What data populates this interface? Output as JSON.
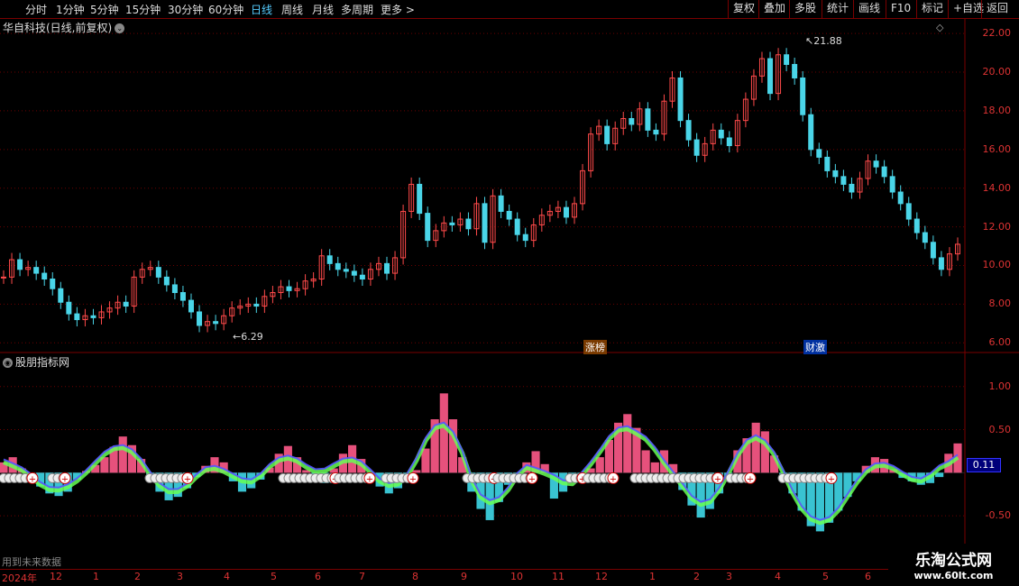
{
  "toolbar": {
    "periods": [
      "分时",
      "1分钟",
      "5分钟",
      "15分钟",
      "30分钟",
      "60分钟",
      "日线",
      "周线",
      "月线",
      "多周期",
      "更多 >"
    ],
    "active_index": 6,
    "right_buttons": [
      "复权",
      "叠加",
      "多股",
      "统计",
      "画线",
      "F10",
      "标记",
      "+自选",
      "返回"
    ]
  },
  "main": {
    "title": "华自科技(日线,前复权)",
    "high_label": "21.88",
    "low_label": "6.29",
    "events": [
      "涨榜",
      "财激"
    ]
  },
  "sub": {
    "title": "股朋指标网",
    "current_value": "0.11",
    "warning": "用到未来数据"
  },
  "date_axis": [
    "2024年",
    "12",
    "1",
    "2",
    "3",
    "4",
    "5",
    "6",
    "7",
    "8",
    "9",
    "10",
    "11",
    "12",
    "1",
    "2",
    "3",
    "4",
    "5",
    "6"
  ],
  "watermark": {
    "line1": "乐淘公式网",
    "line2": "www.60lt.com"
  },
  "colors": {
    "up": "#ff4a4a",
    "down": "#4ad5e8",
    "grid": "#6a0000",
    "axis": "#d33"
  },
  "chart_data": [
    {
      "type": "line",
      "name": "price",
      "y_ticks": [
        "22.00",
        "20.00",
        "18.00",
        "16.00",
        "14.00",
        "12.00",
        "10.00",
        "8.00",
        "6.00"
      ],
      "ylim": [
        5.5,
        22.8
      ],
      "values": [
        9.4,
        10.3,
        9.8,
        9.9,
        9.6,
        9.3,
        8.8,
        8.1,
        7.5,
        7.2,
        7.4,
        7.3,
        7.6,
        7.8,
        8.1,
        7.9,
        9.4,
        9.8,
        9.9,
        9.4,
        9.0,
        8.6,
        8.2,
        7.6,
        6.9,
        7.1,
        7.0,
        7.4,
        7.8,
        7.9,
        8.0,
        7.9,
        8.4,
        8.6,
        8.9,
        8.7,
        8.8,
        9.2,
        9.3,
        10.5,
        10.1,
        9.8,
        9.7,
        9.5,
        9.3,
        9.8,
        10.1,
        9.6,
        10.4,
        12.8,
        14.2,
        12.7,
        11.3,
        11.8,
        12.2,
        12.1,
        12.4,
        11.9,
        13.2,
        11.2,
        13.6,
        12.8,
        12.4,
        11.6,
        11.3,
        12.1,
        12.6,
        12.8,
        13.0,
        12.5,
        13.2,
        14.9,
        16.8,
        17.2,
        16.3,
        17.1,
        17.6,
        17.3,
        18.1,
        17.0,
        16.8,
        18.5,
        19.7,
        17.5,
        16.5,
        15.7,
        16.3,
        17.0,
        16.6,
        16.2,
        17.5,
        18.6,
        19.8,
        20.7,
        18.9,
        20.9,
        20.4,
        19.7,
        17.8,
        16.0,
        15.6,
        14.9,
        14.6,
        14.2,
        13.8,
        14.5,
        15.4,
        15.1,
        14.6,
        13.8,
        13.2,
        12.4,
        11.7,
        11.2,
        10.4,
        9.8,
        10.6,
        11.1
      ]
    },
    {
      "type": "bar",
      "name": "indicator",
      "y_ticks": [
        "1.00",
        "0.50",
        "-0.50"
      ],
      "ylim": [
        -1.0,
        1.3
      ],
      "values": [
        0.12,
        0.18,
        0.05,
        -0.05,
        -0.16,
        -0.24,
        -0.27,
        -0.22,
        -0.08,
        0.02,
        0.09,
        0.18,
        0.3,
        0.42,
        0.32,
        0.16,
        -0.06,
        -0.22,
        -0.32,
        -0.28,
        -0.18,
        -0.05,
        0.08,
        0.18,
        0.12,
        -0.1,
        -0.22,
        -0.18,
        -0.08,
        0.06,
        0.22,
        0.31,
        0.18,
        0.03,
        -0.1,
        -0.12,
        0.05,
        0.22,
        0.32,
        0.16,
        -0.06,
        -0.16,
        -0.24,
        -0.18,
        -0.08,
        0.03,
        0.28,
        0.62,
        0.92,
        0.62,
        0.18,
        -0.22,
        -0.42,
        -0.55,
        -0.34,
        -0.14,
        -0.05,
        0.12,
        0.25,
        0.1,
        -0.3,
        -0.22,
        -0.1,
        -0.05,
        0.05,
        0.18,
        0.38,
        0.58,
        0.68,
        0.52,
        0.26,
        0.12,
        0.26,
        0.1,
        -0.2,
        -0.38,
        -0.52,
        -0.42,
        -0.24,
        -0.06,
        0.26,
        0.4,
        0.58,
        0.48,
        0.2,
        -0.02,
        -0.24,
        -0.44,
        -0.62,
        -0.68,
        -0.58,
        -0.44,
        -0.28,
        -0.1,
        0.08,
        0.18,
        0.16,
        0.04,
        -0.06,
        -0.1,
        -0.14,
        -0.12,
        -0.05,
        0.22,
        0.34
      ]
    }
  ]
}
